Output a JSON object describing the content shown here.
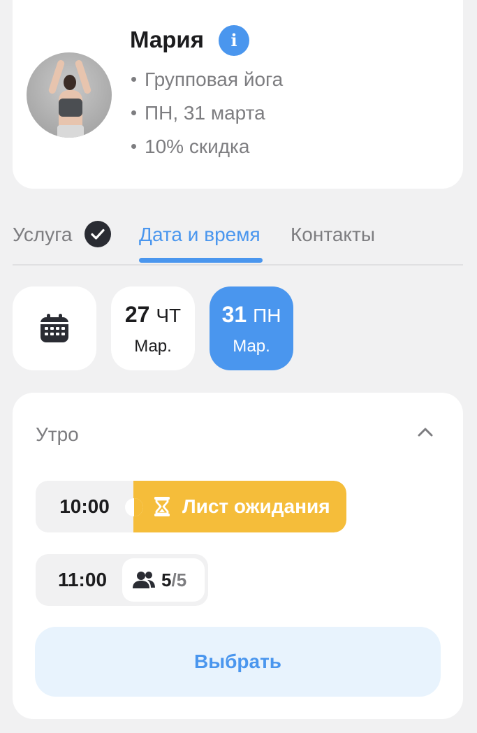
{
  "profile": {
    "name": "Мария",
    "info_icon": "info-icon",
    "details": [
      "Групповая йога",
      "ПН, 31 марта",
      "10% скидка"
    ]
  },
  "tabs": [
    {
      "label": "Услуга",
      "state": "done"
    },
    {
      "label": "Дата и время",
      "state": "active"
    },
    {
      "label": "Контакты",
      "state": "inactive"
    }
  ],
  "dates": [
    {
      "day": "27",
      "weekday": "ЧТ",
      "month": "Мар.",
      "selected": false
    },
    {
      "day": "31",
      "weekday": "ПН",
      "month": "Мар.",
      "selected": true
    }
  ],
  "section": {
    "title": "Утро",
    "slots": [
      {
        "time": "10:00",
        "status": "Лист ожидания"
      },
      {
        "time": "11:00",
        "booked": "5",
        "capacity": "/5"
      }
    ]
  },
  "select_button": "Выбрать",
  "colors": {
    "accent": "#4a96ee",
    "waitlist": "#f5bd3a",
    "background": "#f1f1f2",
    "muted_text": "#7d7d80"
  }
}
